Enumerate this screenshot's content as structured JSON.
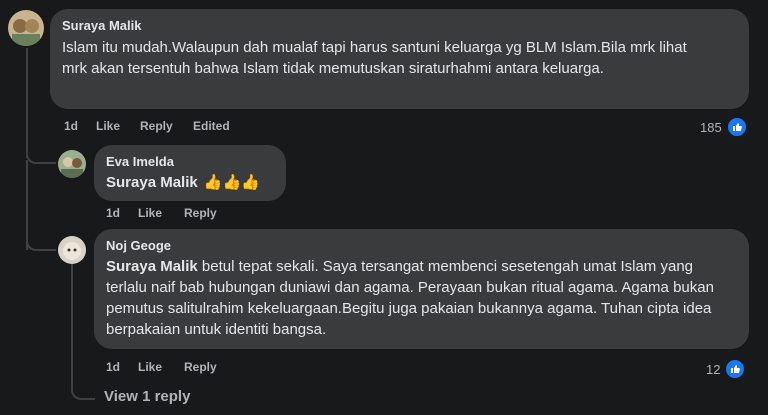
{
  "comments": [
    {
      "author": "Suraya Malik",
      "text": "Islam itu mudah.Walaupun dah mualaf tapi harus santuni keluarga yg BLM Islam.Bila mrk lihat mrk akan tersentuh bahwa Islam tidak memutuskan siraturhahmi antara keluarga.",
      "time": "1d",
      "like": "Like",
      "reply": "Reply",
      "edited": "Edited",
      "reaction_count": "185"
    }
  ],
  "replies": [
    {
      "author": "Eva Imelda",
      "mention": "Suraya Malik",
      "text": "",
      "emoji": "👍👍👍",
      "time": "1d",
      "like": "Like",
      "reply": "Reply"
    },
    {
      "author": "Noj Geoge",
      "mention": "Suraya Malik",
      "text": " betul tepat sekali. Saya tersangat membenci sesetengah umat Islam yang terlalu naif bab hubungan duniawi dan agama. Perayaan bukan ritual agama. Agama bukan pemutus salitulrahim kekeluargaan.Begitu juga pakaian bukannya agama. Tuhan cipta idea berpakaian untuk identiti bangsa.",
      "time": "1d",
      "like": "Like",
      "reply": "Reply",
      "reaction_count": "12"
    }
  ],
  "view_replies": "View 1 reply",
  "colors": {
    "background": "#18191a",
    "bubble": "#3a3b3c",
    "like_blue": "#1877f2",
    "secondary_text": "#b0b3b8"
  }
}
